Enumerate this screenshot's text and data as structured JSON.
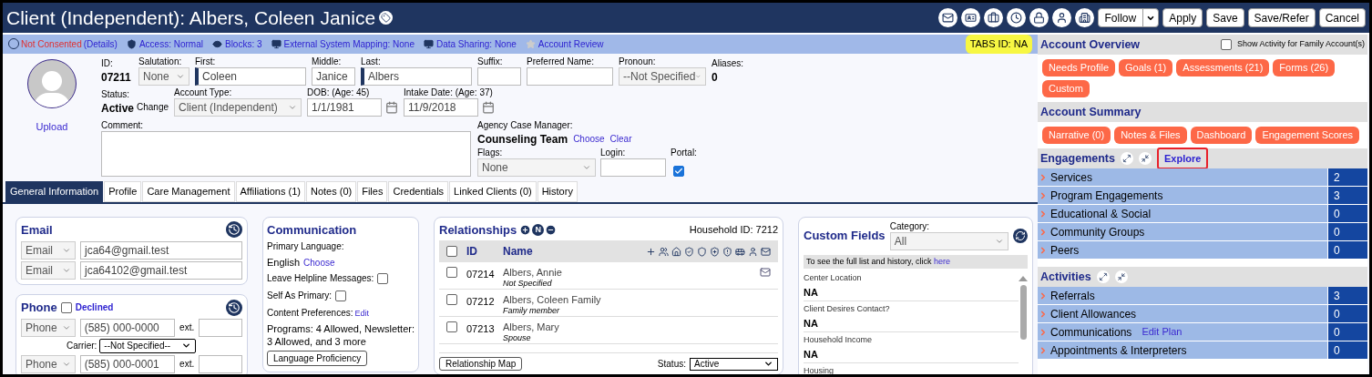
{
  "header": {
    "title": "Client (Independent): Albers, Coleen Janice",
    "buttons": [
      {
        "label": "Follow",
        "kind": "split"
      },
      {
        "label": "Apply",
        "kind": "plain"
      },
      {
        "label": "Save",
        "kind": "plain"
      },
      {
        "label": "Save/Refer",
        "kind": "plain"
      },
      {
        "label": "Cancel",
        "kind": "plain"
      }
    ]
  },
  "info_bar": {
    "consent": "Not Consented",
    "consent_details": "(Details)",
    "items": [
      "Access: Normal",
      "Blocks: 3",
      "External System Mapping: None",
      "Data Sharing: None",
      "Account Review"
    ],
    "badge": "TABS ID: NA"
  },
  "profile": {
    "upload": "Upload",
    "id_label": "ID:",
    "id": "07211",
    "salutation": {
      "label": "Salutation:",
      "value": "None"
    },
    "first": {
      "label": "First:",
      "value": "Coleen"
    },
    "middle": {
      "label": "Middle:",
      "value": "Janice"
    },
    "last": {
      "label": "Last:",
      "value": "Albers"
    },
    "suffix": {
      "label": "Suffix:"
    },
    "preferred": {
      "label": "Preferred Name:"
    },
    "pronoun": {
      "label": "Pronoun:",
      "value": "--Not Specified"
    },
    "aliases": {
      "label": "Aliases:",
      "value": "0"
    },
    "status": {
      "label": "Status:",
      "value": "Active",
      "action": "Change"
    },
    "account_type": {
      "label": "Account Type:",
      "value": "Client (Independent)"
    },
    "dob": {
      "label": "DOB: (Age: 45)",
      "value": "1/1/1981"
    },
    "intake": {
      "label": "Intake Date: (Age: 37)",
      "value": "11/9/2018"
    },
    "comment": {
      "label": "Comment:"
    },
    "case_manager": {
      "label": "Agency Case Manager:",
      "value": "Counseling Team",
      "links": [
        "Choose",
        "Clear"
      ]
    },
    "flags": {
      "label": "Flags:",
      "value": "None"
    },
    "login": {
      "label": "Login:"
    },
    "portal": {
      "label": "Portal:",
      "checked": true
    }
  },
  "tabs": [
    {
      "label": "General Information",
      "selected": true
    },
    {
      "label": "Profile",
      "selected": false
    },
    {
      "label": "Care Management",
      "selected": false
    },
    {
      "label": "Affiliations (1)",
      "selected": false
    },
    {
      "label": "Notes (0)",
      "selected": false
    },
    {
      "label": "Files",
      "selected": false
    },
    {
      "label": "Credentials",
      "selected": false
    },
    {
      "label": "Linked Clients (0)",
      "selected": false
    },
    {
      "label": "History",
      "selected": false
    }
  ],
  "email": {
    "title": "Email",
    "entries": [
      {
        "type": "Email",
        "value": "jca64@gmail.test"
      },
      {
        "type": "Email",
        "value": "jca64102@gmail.test"
      }
    ]
  },
  "phone": {
    "title": "Phone",
    "declined": {
      "label": "Declined",
      "checked": false
    },
    "carrier": {
      "label": "Carrier:",
      "value": "--Not Specified--"
    },
    "entries": [
      {
        "type": "Phone",
        "value": "(585) 000-0000",
        "ext_label": "ext."
      },
      {
        "type": "Phone",
        "value": "(585) 000-0001",
        "ext_label": "ext."
      }
    ]
  },
  "communication": {
    "title": "Communication",
    "language_label": "Primary Language:",
    "language": "English",
    "choose": "Choose",
    "helpline": {
      "label": "Leave Helpline Messages:",
      "checked": false
    },
    "self_primary": {
      "label": "Self As Primary:",
      "checked": false
    },
    "content_label": "Content Preferences:",
    "edit": "Edit",
    "programs": "Programs: 4 Allowed, Newsletter: 3 Allowed, and 3 more",
    "button": "Language Proficiency"
  },
  "relationships": {
    "title": "Relationships",
    "n_button": "N",
    "household": "Household ID: 7212",
    "all_checked": false,
    "columns": [
      "ID",
      "Name"
    ],
    "rows": [
      {
        "id": "07214",
        "name": "Albers, Annie",
        "relation": "Not Specified",
        "checked": false,
        "email": true
      },
      {
        "id": "07212",
        "name": "Albers, Coleen Family",
        "relation": "Family member",
        "checked": false,
        "email": false
      },
      {
        "id": "07213",
        "name": "Albers, Mary",
        "relation": "Spouse",
        "checked": false,
        "email": false
      }
    ],
    "map_button": "Relationship Map",
    "status_label": "Status:",
    "status": "Active"
  },
  "custom_fields": {
    "title": "Custom Fields",
    "category_label": "Category:",
    "category": "All",
    "notice": "To see the full list and history, click",
    "link": "here",
    "fields": [
      {
        "label": "Center Location",
        "value": "NA"
      },
      {
        "label": "Client Desires Contact?",
        "value": "NA"
      },
      {
        "label": "Household Income",
        "value": "NA"
      },
      {
        "label": "Housing"
      }
    ]
  },
  "overview": {
    "title": "Account Overview",
    "family": {
      "label": "Show Activity for Family Account(s)",
      "checked": false
    },
    "buttons": [
      "Needs Profile",
      "Goals (1)",
      "Assessments (21)",
      "Forms (26)",
      "Custom"
    ]
  },
  "summary": {
    "title": "Account Summary",
    "buttons": [
      "Narrative (0)",
      "Notes & Files",
      "Dashboard",
      "Engagement Scores"
    ]
  },
  "engagements": {
    "title": "Engagements",
    "explore": "Explore",
    "highlighted": true,
    "rows": [
      {
        "label": "Services",
        "count": "2"
      },
      {
        "label": "Program Engagements",
        "count": "3"
      },
      {
        "label": "Educational & Social",
        "count": "0"
      },
      {
        "label": "Community Groups",
        "count": "0"
      },
      {
        "label": "Peers",
        "count": "0"
      }
    ]
  },
  "activities": {
    "title": "Activities",
    "rows": [
      {
        "label": "Referrals",
        "count": "3"
      },
      {
        "label": "Client Allowances",
        "count": "0"
      },
      {
        "label": "Communications",
        "count": "0",
        "link": "Edit Plan"
      },
      {
        "label": "Appointments & Interpreters",
        "count": "0"
      }
    ]
  }
}
